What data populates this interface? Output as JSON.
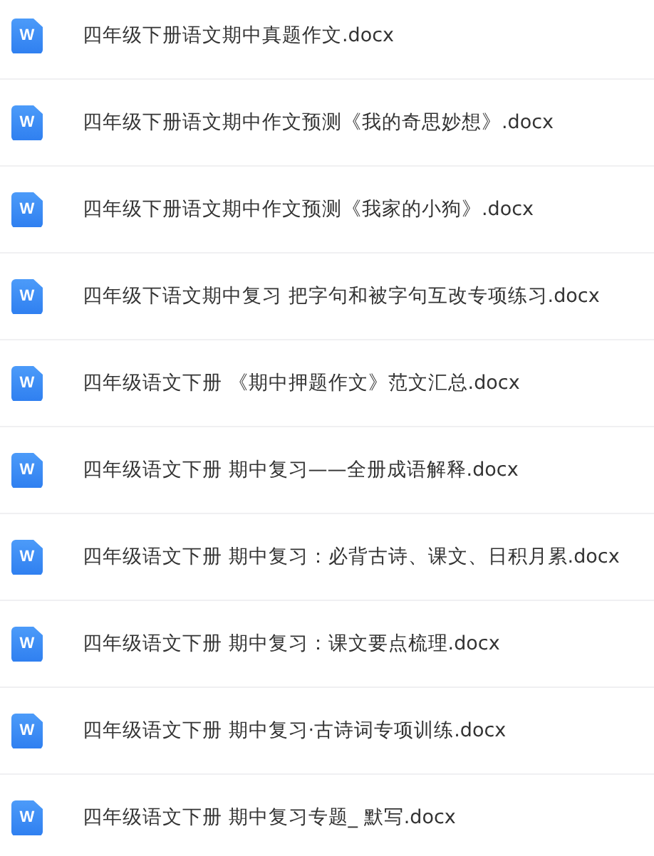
{
  "files": [
    {
      "name": "四年级下册语文期中真题作文.docx",
      "icon": "W"
    },
    {
      "name": "四年级下册语文期中作文预测《我的奇思妙想》.docx",
      "icon": "W"
    },
    {
      "name": "四年级下册语文期中作文预测《我家的小狗》.docx",
      "icon": "W"
    },
    {
      "name": "四年级下语文期中复习 把字句和被字句互改专项练习.docx",
      "icon": "W"
    },
    {
      "name": "四年级语文下册 《期中押题作文》范文汇总.docx",
      "icon": "W"
    },
    {
      "name": "四年级语文下册 期中复习——全册成语解释.docx",
      "icon": "W"
    },
    {
      "name": "四年级语文下册 期中复习：必背古诗、课文、日积月累.docx",
      "icon": "W"
    },
    {
      "name": "四年级语文下册 期中复习：课文要点梳理.docx",
      "icon": "W"
    },
    {
      "name": "四年级语文下册 期中复习·古诗词专项训练.docx",
      "icon": "W"
    },
    {
      "name": "四年级语文下册 期中复习专题_ 默写.docx",
      "icon": "W"
    }
  ]
}
